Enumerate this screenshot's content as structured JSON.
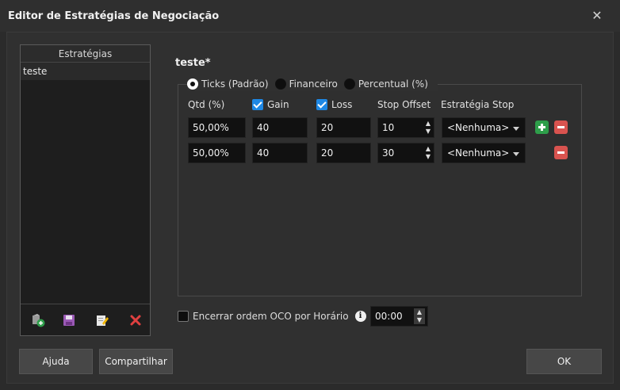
{
  "window": {
    "title": "Editor de Estratégias de Negociação",
    "close_label": "✕"
  },
  "strategies_panel": {
    "header": "Estratégias",
    "items": [
      "teste"
    ],
    "toolbar": {
      "new_icon": "new-strategy-icon",
      "save_icon": "save-icon",
      "edit_icon": "edit-icon",
      "delete_icon": "delete-icon"
    }
  },
  "editor": {
    "strategy_name": "teste*",
    "mode_options": [
      {
        "label": "Ticks (Padrão)",
        "checked": true
      },
      {
        "label": "Financeiro",
        "checked": false
      },
      {
        "label": "Percentual (%)",
        "checked": false
      }
    ],
    "columns": {
      "qtd": "Qtd (%)",
      "gain": "Gain",
      "gain_checked": true,
      "loss": "Loss",
      "loss_checked": true,
      "stop_offset": "Stop Offset",
      "stop_strategy": "Estratégia Stop"
    },
    "rows": [
      {
        "qtd": "50,00%",
        "gain": "40",
        "loss": "20",
        "stop_offset": "10",
        "stop_strategy": "<Nenhuma>"
      },
      {
        "qtd": "50,00%",
        "gain": "40",
        "loss": "20",
        "stop_offset": "30",
        "stop_strategy": "<Nenhuma>"
      }
    ],
    "oco": {
      "label": "Encerrar ordem OCO por Horário",
      "checked": false,
      "time": "00:00",
      "info_glyph": "i"
    }
  },
  "buttons": {
    "help": "Ajuda",
    "share": "Compartilhar",
    "ok": "OK"
  },
  "colors": {
    "add": "#2e9e4a",
    "remove": "#d9534f",
    "checkbox": "#1e88e5"
  }
}
